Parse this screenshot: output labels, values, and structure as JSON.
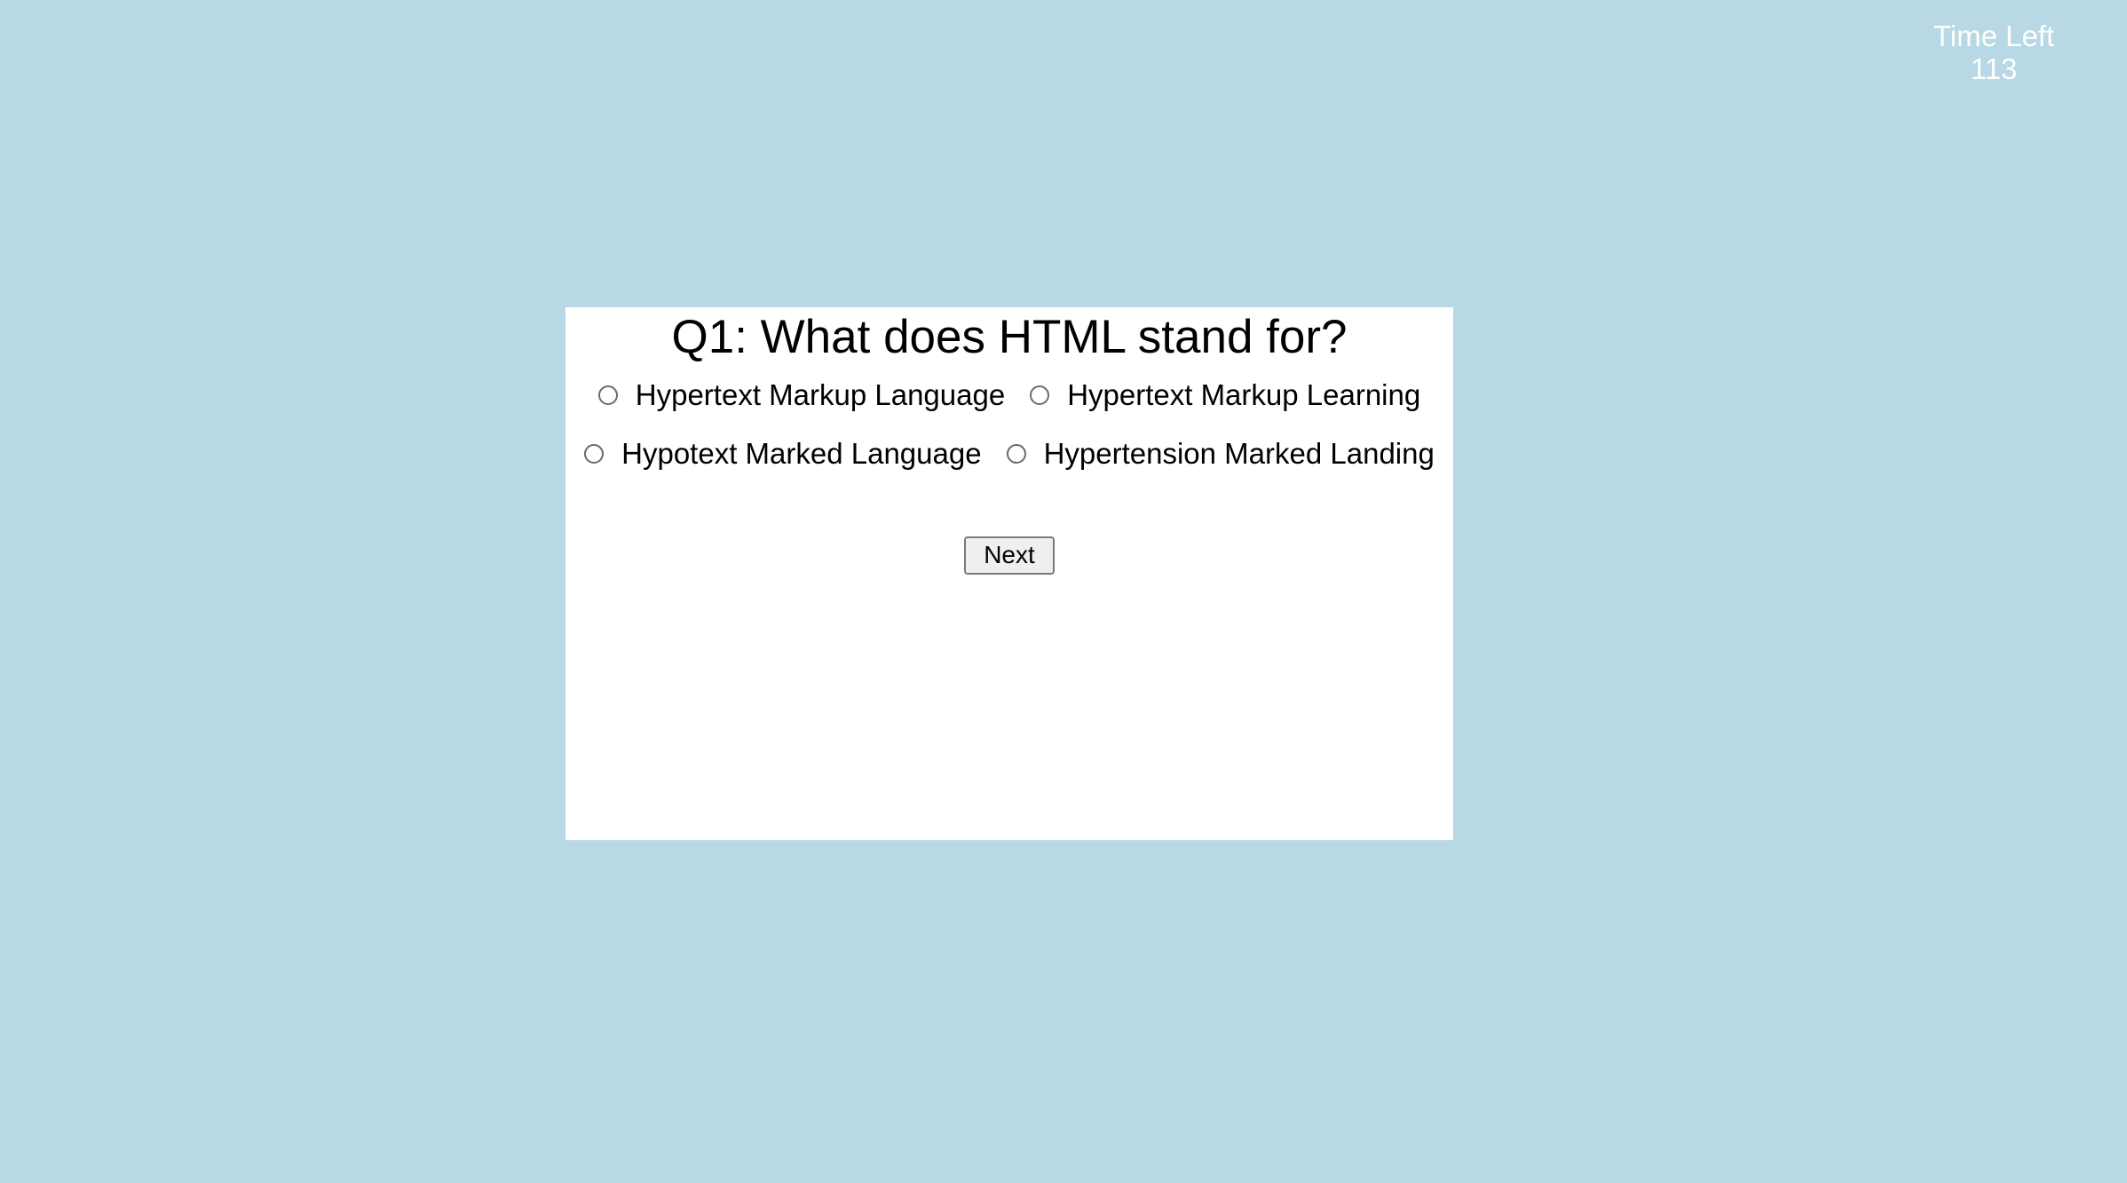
{
  "timer": {
    "label": "Time Left",
    "value": "113"
  },
  "quiz": {
    "question": "Q1: What does HTML stand for?",
    "options": [
      "Hypertext Markup Language",
      "Hypertext Markup Learning",
      "Hypotext Marked Language",
      "Hypertension Marked Landing"
    ],
    "next_label": "Next"
  }
}
